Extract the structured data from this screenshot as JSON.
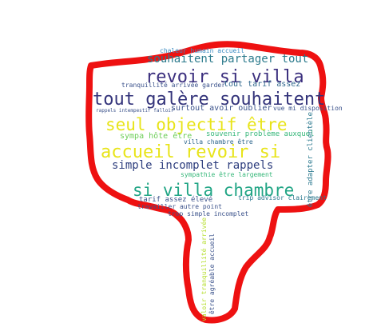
{
  "outline_color": "#ee1111",
  "words": [
    {
      "key": "w1",
      "text": "chaleur humain accueil",
      "color": "#3b8bc2"
    },
    {
      "key": "w2",
      "text": "souhaitent partager tout",
      "color": "#2b7a8c"
    },
    {
      "key": "w3",
      "text": "revoir si villa",
      "color": "#3b2f7e"
    },
    {
      "key": "w4",
      "text": "tranquillité arrivée garder",
      "color": "#3b528b"
    },
    {
      "key": "w5",
      "text": "tout tarif assez",
      "color": "#31688e"
    },
    {
      "key": "w6",
      "text": "tout galère souhaitent",
      "color": "#33337a"
    },
    {
      "key": "w7",
      "text": "surtout avoir oublier",
      "color": "#3b528b"
    },
    {
      "key": "w8",
      "text": "vue mi disposition",
      "color": "#3b528b"
    },
    {
      "key": "w9",
      "text": "seul objectif être",
      "color": "#e8e419"
    },
    {
      "key": "w10",
      "text": "souvenir problème auxquel",
      "color": "#35b779"
    },
    {
      "key": "w11",
      "text": "sympa hôte être",
      "color": "#6ece58"
    },
    {
      "key": "w12",
      "text": "villa chambre être",
      "color": "#31688e"
    },
    {
      "key": "w13",
      "text": "accueil revoir si",
      "color": "#e8e419"
    },
    {
      "key": "w14",
      "text": "simple incomplet rappels",
      "color": "#2e3e7e"
    },
    {
      "key": "w15",
      "text": "sympathie être largement",
      "color": "#35b779"
    },
    {
      "key": "w16",
      "text": "si villa chambre",
      "color": "#21a585"
    },
    {
      "key": "w17",
      "text": "trip advisor clairement",
      "color": "#2a788e"
    },
    {
      "key": "w18",
      "text": "tarif assez élevé",
      "color": "#3b528b"
    },
    {
      "key": "w19",
      "text": "travailler autre point",
      "color": "#3b528b"
    },
    {
      "key": "w20",
      "text": "trop simple incomplet",
      "color": "#3b528b"
    },
    {
      "key": "w21",
      "text": "être adapter clientèle",
      "color": "#2a788e"
    },
    {
      "key": "w22",
      "text": "être agréable accueil",
      "color": "#3b528b"
    },
    {
      "key": "w23",
      "text": "valoir tranquillité arrivée",
      "color": "#b5de2b"
    },
    {
      "key": "w24",
      "text": "rappels intempestif falloir",
      "color": "#3b528b"
    }
  ]
}
